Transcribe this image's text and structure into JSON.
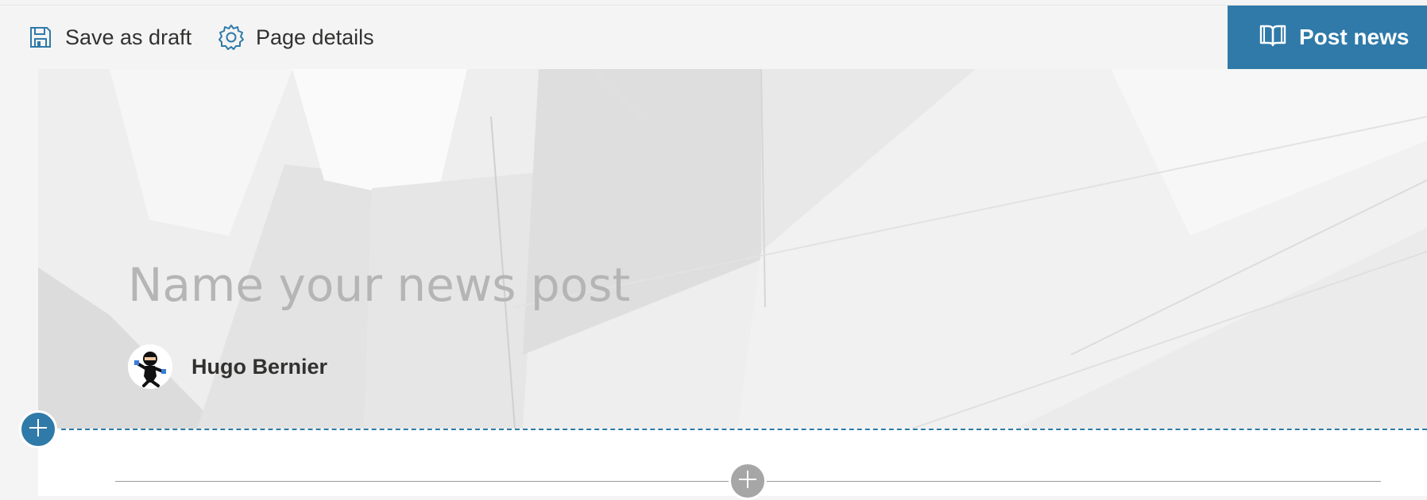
{
  "command_bar": {
    "save_draft_label": "Save as draft",
    "page_details_label": "Page details",
    "post_news_label": "Post news",
    "save_icon": "save-icon",
    "details_icon": "gear-icon",
    "post_icon": "book-icon"
  },
  "header": {
    "title_placeholder": "Name your news post",
    "title_value": "",
    "author_name": "Hugo Bernier"
  },
  "controls": {
    "add_section_icon": "plus-icon",
    "add_webpart_icon": "plus-icon"
  },
  "colors": {
    "accent": "#2f7aa8",
    "command_bar_bg": "#f4f4f4",
    "placeholder_text": "#b5b5b5",
    "add_webpart_button": "#a6a6a6"
  }
}
